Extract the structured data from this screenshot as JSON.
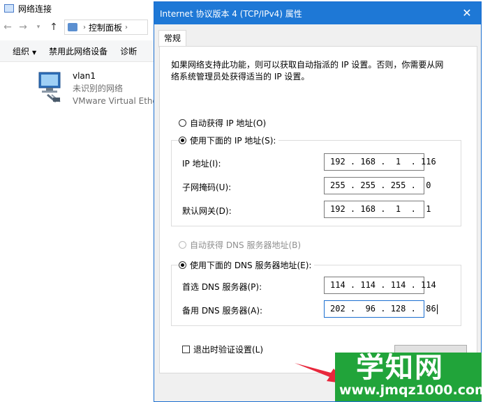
{
  "explorer": {
    "title": "网络连接",
    "address_crumb": "控制面板",
    "toolbar": {
      "organize": "组织",
      "disable": "禁用此网络设备",
      "diagnose": "诊断"
    },
    "adapter": {
      "name": "vlan1",
      "status": "未识别的网络",
      "device": "VMware Virtual Ethe"
    }
  },
  "dialog": {
    "title": "Internet 协议版本 4 (TCP/IPv4) 属性",
    "close_glyph": "✕",
    "tab": "常规",
    "description": "如果网络支持此功能，则可以获取自动指派的 IP 设置。否则，你需要从网络系统管理员处获得适当的 IP 设置。",
    "auto_ip": "自动获得 IP 地址(O)",
    "manual_ip": "使用下面的 IP 地址(S):",
    "ip_label": "IP 地址(I):",
    "ip_value": "192 . 168 .  1  . 116",
    "mask_label": "子网掩码(U):",
    "mask_value": "255 . 255 . 255 .  0",
    "gateway_label": "默认网关(D):",
    "gateway_value": "192 . 168 .  1  .  1",
    "auto_dns": "自动获得 DNS 服务器地址(B)",
    "manual_dns": "使用下面的 DNS 服务器地址(E):",
    "dns1_label": "首选 DNS 服务器(P):",
    "dns1_value": "114 . 114 . 114 . 114",
    "dns2_label": "备用 DNS 服务器(A):",
    "dns2_value": "202 .  96 . 128 .  86",
    "validate": "退出时验证设置(L)",
    "selection": {
      "manual_ip": true,
      "manual_dns": true,
      "validate_checked": false
    }
  },
  "watermark": {
    "brand": "学知网",
    "url": "www.jmqz1000.com"
  },
  "colors": {
    "title_bar": "#1e78d6",
    "watermark": "#21a43a",
    "arrow": "#e8283c"
  }
}
